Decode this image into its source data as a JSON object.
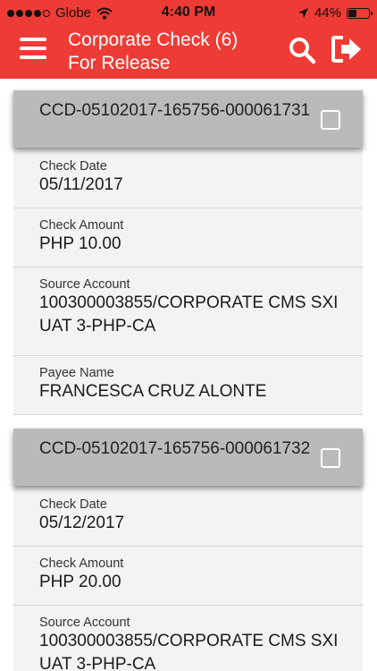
{
  "status_bar": {
    "carrier": "Globe",
    "time": "4:40 PM",
    "battery": "44%",
    "battery_level": 0.44
  },
  "nav": {
    "title_line1": "Corporate Check (6)",
    "title_line2": "For Release",
    "menu_icon": "hamburger-menu-icon",
    "search_icon": "search-icon",
    "logout_icon": "logout-icon"
  },
  "labels": {
    "check_date": "Check Date",
    "check_amount": "Check Amount",
    "source_account": "Source Account",
    "payee_name": "Payee Name"
  },
  "checks": [
    {
      "id": "CCD-05102017-165756-000061731",
      "check_date": "05/11/2017",
      "check_amount": "PHP 10.00",
      "source_account": "100300003855/CORPORATE CMS SXI UAT 3-PHP-CA",
      "payee_name": "FRANCESCA CRUZ ALONTE"
    },
    {
      "id": "CCD-05102017-165756-000061732",
      "check_date": "05/12/2017",
      "check_amount": "PHP 20.00",
      "source_account": "100300003855/CORPORATE CMS SXI UAT 3-PHP-CA"
    }
  ],
  "colors": {
    "accent": "#ef3b36",
    "card_header": "#bababa",
    "field_bg": "#f3f3f3"
  }
}
